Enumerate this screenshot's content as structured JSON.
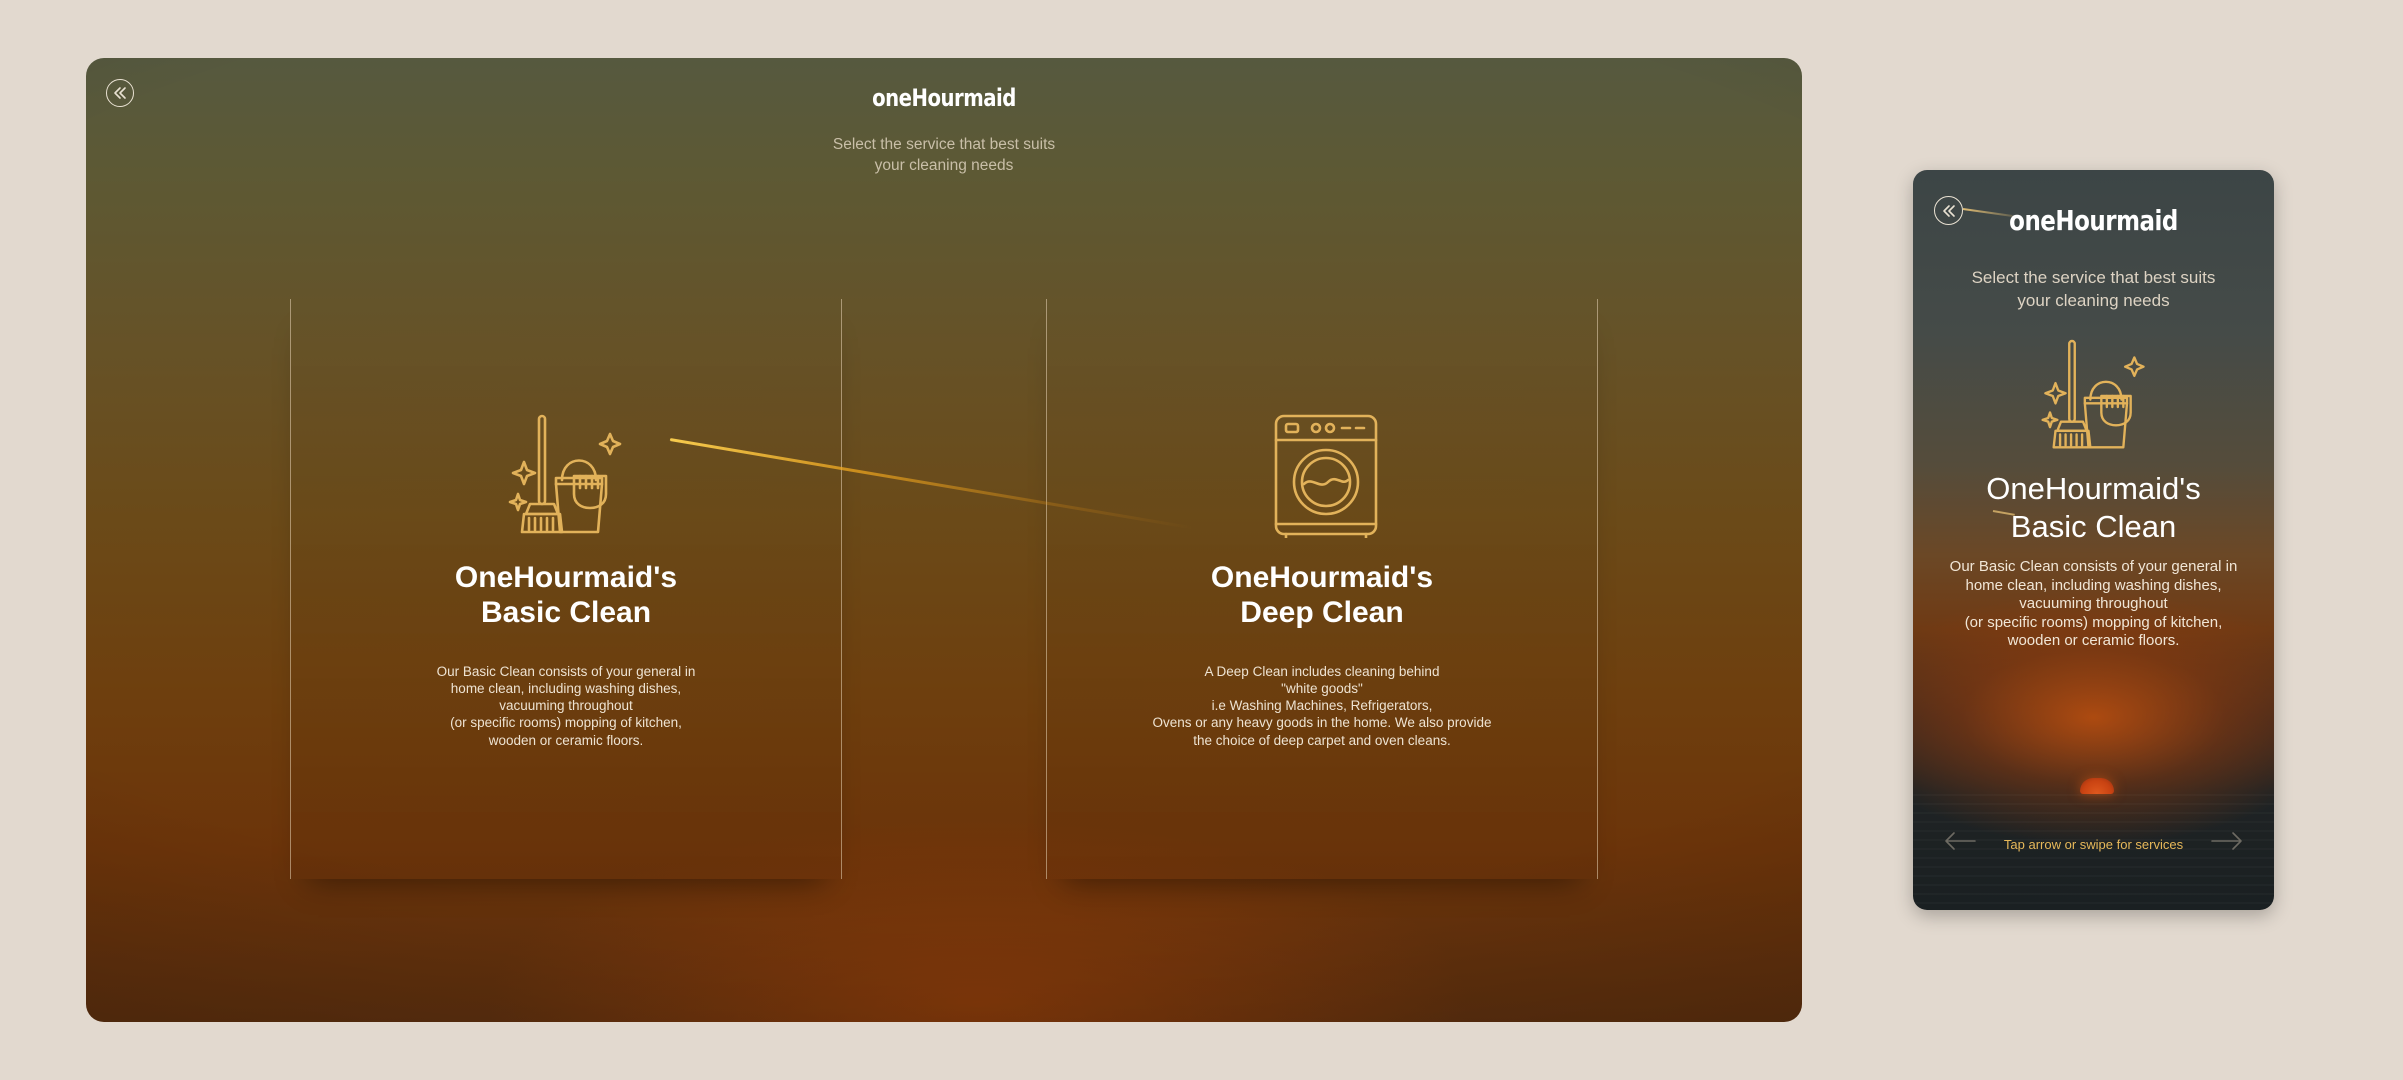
{
  "colors": {
    "page_background": "#e2d9cf",
    "icon_gold": "#e2b25a",
    "hint_text": "#e7b85a",
    "brand_text": "#ffffff"
  },
  "desktop": {
    "back_icon": "double-chevron-left-icon",
    "brand": "oneHourmaid",
    "tagline": "Select the service that best suits\nyour cleaning needs",
    "services": [
      {
        "icon": "broom-bucket-icon",
        "title_line1": "OneHourmaid's",
        "title_line2": "Basic Clean",
        "description": "Our Basic Clean consists of your general in\nhome clean, including washing dishes,\nvacuuming throughout\n(or specific rooms) mopping of kitchen,\nwooden or ceramic floors."
      },
      {
        "icon": "washing-machine-icon",
        "title_line1": "OneHourmaid's",
        "title_line2": "Deep Clean",
        "description": "A Deep Clean includes cleaning behind\n\"white goods\"\ni.e Washing Machines, Refrigerators,\nOvens or any heavy goods in the home. We also provide\nthe choice of deep carpet and oven cleans."
      }
    ]
  },
  "mobile": {
    "back_icon": "double-chevron-left-icon",
    "brand": "oneHourmaid",
    "tagline": "Select the service that best suits\nyour cleaning needs",
    "service": {
      "icon": "broom-bucket-icon",
      "title_line1": "OneHourmaid's",
      "title_line2": "Basic Clean",
      "description": "Our Basic Clean consists of your general in\nhome clean, including washing dishes,\nvacuuming throughout\n(or specific rooms) mopping of kitchen,\nwooden or ceramic floors."
    },
    "prev_icon": "arrow-left-icon",
    "next_icon": "arrow-right-icon",
    "swipe_hint": "Tap arrow or swipe for services"
  }
}
